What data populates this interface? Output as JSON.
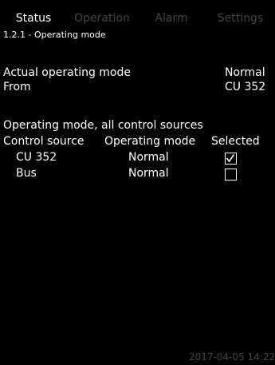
{
  "tabs": {
    "status": "Status",
    "operation": "Operation",
    "alarm": "Alarm",
    "settings": "Settings"
  },
  "breadcrumb": "1.2.1 - Operating mode",
  "actual": {
    "label": "Actual operating mode",
    "value": "Normal",
    "from_label": "From",
    "from_value": "CU 352"
  },
  "sources": {
    "section_title": "Operating mode, all control sources",
    "headers": {
      "control_source": "Control source",
      "operating_mode": "Operating mode",
      "selected": "Selected"
    },
    "rows": [
      {
        "source": "CU 352",
        "mode": "Normal",
        "selected": true
      },
      {
        "source": "Bus",
        "mode": "Normal",
        "selected": false
      }
    ]
  },
  "timestamp": "2017-04-05 14:22",
  "colors": {
    "background": "#000000",
    "text": "#ffffff",
    "inactive_tab": "#3f4548"
  }
}
